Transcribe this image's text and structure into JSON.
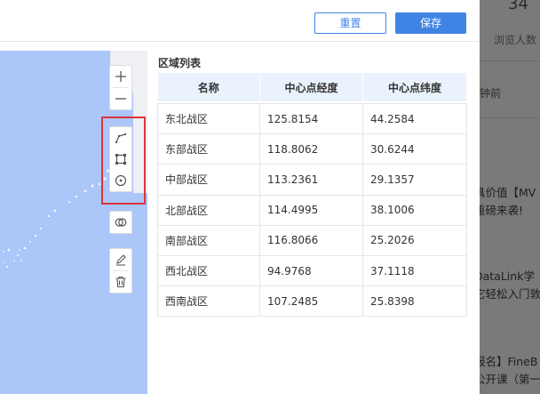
{
  "toolbar": {
    "reset_label": "重置",
    "save_label": "保存"
  },
  "map_tools": {
    "zoom_in": "zoom-in-icon",
    "zoom_out": "zoom-out-icon",
    "draw_polyline": "polyline-icon",
    "draw_rectangle": "rectangle-icon",
    "draw_circle": "circle-icon",
    "merge": "merge-circles-icon",
    "edit": "pencil-icon",
    "delete": "trash-icon"
  },
  "region_list": {
    "title": "区域列表",
    "columns": [
      "名称",
      "中心点经度",
      "中心点纬度"
    ],
    "rows": [
      [
        "东北战区",
        "125.8154",
        "44.2584"
      ],
      [
        "东部战区",
        "118.8062",
        "30.6244"
      ],
      [
        "中部战区",
        "113.2361",
        "29.1357"
      ],
      [
        "北部战区",
        "114.4995",
        "38.1006"
      ],
      [
        "南部战区",
        "116.8066",
        "25.2026"
      ],
      [
        "西北战区",
        "94.9768",
        "37.1118"
      ],
      [
        "西南战区",
        "107.2485",
        "25.8398"
      ]
    ]
  },
  "background": {
    "count": "34",
    "viewers": "浏览人数",
    "time": "钟前",
    "news": [
      "具价值【MV",
      "重磅来袭!",
      "DataLink学",
      "它轻松入门敦",
      "报名】FineB",
      "公开课（第一"
    ]
  },
  "colors": {
    "primary": "#3f84e5",
    "highlight": "#e0343c",
    "sea": "#abc6f8"
  }
}
